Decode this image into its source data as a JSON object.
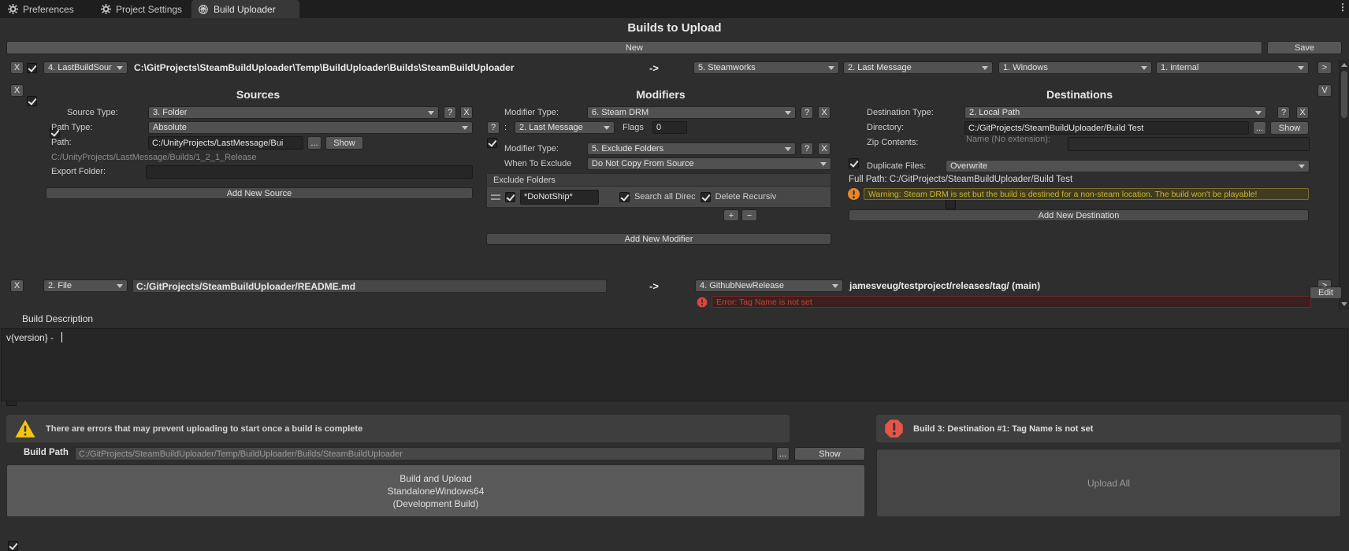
{
  "tabbar": {
    "preferences": "Preferences",
    "project_settings": "Project Settings",
    "build_uploader": "Build Uploader",
    "overflow": "⋮"
  },
  "header": {
    "title": "Builds to Upload",
    "new": "New",
    "save": "Save"
  },
  "ui": {
    "remove": "X",
    "help": "?",
    "browse": "...",
    "show": "Show",
    "arrow": "->",
    "expand": ">",
    "collapse": "V",
    "plus": "+",
    "minus": "−",
    "colon": ":"
  },
  "build1": {
    "type": "4. LastBuildSour",
    "path": "C:\\GitProjects\\SteamBuildUploader\\Temp\\BuildUploader\\Builds\\SteamBuildUploader",
    "dest1": "5. Steamworks",
    "dest2": "2. Last Message",
    "dest3": "1. Windows",
    "dest4": "1. internal"
  },
  "sources": {
    "title": "Sources",
    "type_label": "Source Type:",
    "type_value": "3. Folder",
    "path_type_label": "Path Type:",
    "path_type_value": "Absolute",
    "path_label": "Path:",
    "path_value": "C:/UnityProjects/LastMessage/Bui",
    "resolved_path": "C:/UnityProjects/LastMessage/Builds/1_2_1_Release",
    "export_label": "Export Folder:",
    "export_value": "",
    "add_button": "Add New Source"
  },
  "modifiers": {
    "title": "Modifiers",
    "type_label": "Modifier Type:",
    "mod1_value": "6. Steam DRM",
    "mod1_sub_value": "2. Last Message",
    "flags_label": "Flags",
    "flags_value": "0",
    "mod2_value": "5. Exclude Folders",
    "when_label": "When To Exclude",
    "when_value": "Do Not Copy From Source",
    "list_header": "Exclude Folders",
    "pattern": "*DoNotShip*",
    "search_label": "Search all Direc",
    "delete_label": "Delete Recursiv",
    "add_button": "Add New Modifier"
  },
  "destinations": {
    "title": "Destinations",
    "type_label": "Destination Type:",
    "type_value": "2. Local Path",
    "dir_label": "Directory:",
    "dir_value": "C:/GitProjects/SteamBuildUploader/Build Test",
    "zip_label": "Zip Contents:",
    "zip_name_label": "Name (No extension):",
    "zip_name_value": "",
    "dup_label": "Duplicate Files:",
    "dup_value": "Overwrite",
    "full_path": "Full Path: C:/GitProjects/SteamBuildUploader/Build Test",
    "warning": "Warning: Steam DRM is set but the build is destined for a non-steam location. The build won't be playable!",
    "add_button": "Add New Destination"
  },
  "build3": {
    "type": "2. File",
    "path": "C:/GitProjects/SteamBuildUploader/README.md",
    "dest_type": "4. GithubNewRelease",
    "dest_info": "jamesveug/testproject/releases/tag/ (main)",
    "error": "Error: Tag Name is not set"
  },
  "description": {
    "label": "Build Description",
    "edit_button": "Edit",
    "text": "v{version} - "
  },
  "footer": {
    "warning": "There are errors that may prevent uploading to start once a build is complete",
    "error": "Build 3: Destination #1: Tag Name is not set",
    "build_path_label": "Build Path",
    "build_path_value": "C:/GitProjects/SteamBuildUploader/Temp/BuildUploader/Builds/SteamBuildUploader",
    "build_line1": "Build and Upload",
    "build_line2": "StandaloneWindows64",
    "build_line3": "(Development Build)",
    "upload_all": "Upload All"
  },
  "colors": {
    "warning_icon": "#f3c512",
    "warning_text": "#c9b832",
    "error_icon": "#e8544a",
    "error_text": "#c4443c"
  }
}
